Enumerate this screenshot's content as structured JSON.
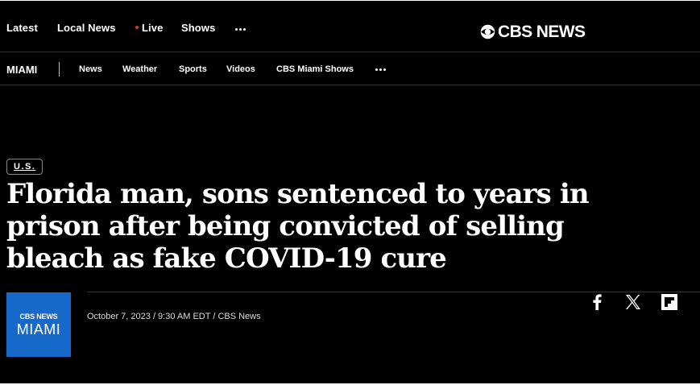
{
  "topnav": {
    "items": [
      {
        "label": "Latest"
      },
      {
        "label": "Local News"
      },
      {
        "label": "Live"
      },
      {
        "label": "Shows"
      }
    ],
    "more_icon": "more-dots-icon",
    "live_dot_color": "#e5332a"
  },
  "logo": {
    "text": "CBS NEWS",
    "icon": "cbs-eye-icon"
  },
  "subnav": {
    "station": "MIAMI",
    "items": [
      {
        "label": "News"
      },
      {
        "label": "Weather"
      },
      {
        "label": "Sports"
      },
      {
        "label": "Videos"
      },
      {
        "label": "CBS Miami Shows"
      }
    ],
    "more_icon": "more-dots-icon"
  },
  "article": {
    "category": "U.S.",
    "headline": "Florida man, sons sentenced to years in prison after being convicted of selling bleach as fake COVID-19 cure",
    "byline": "October 7, 2023 / 9:30 AM EDT / CBS News",
    "station_logo": {
      "top": "CBS NEWS",
      "bottom": "MIAMI",
      "color": "#1769c9"
    }
  },
  "share": {
    "icons": [
      "facebook-icon",
      "x-icon",
      "flipboard-icon"
    ]
  }
}
